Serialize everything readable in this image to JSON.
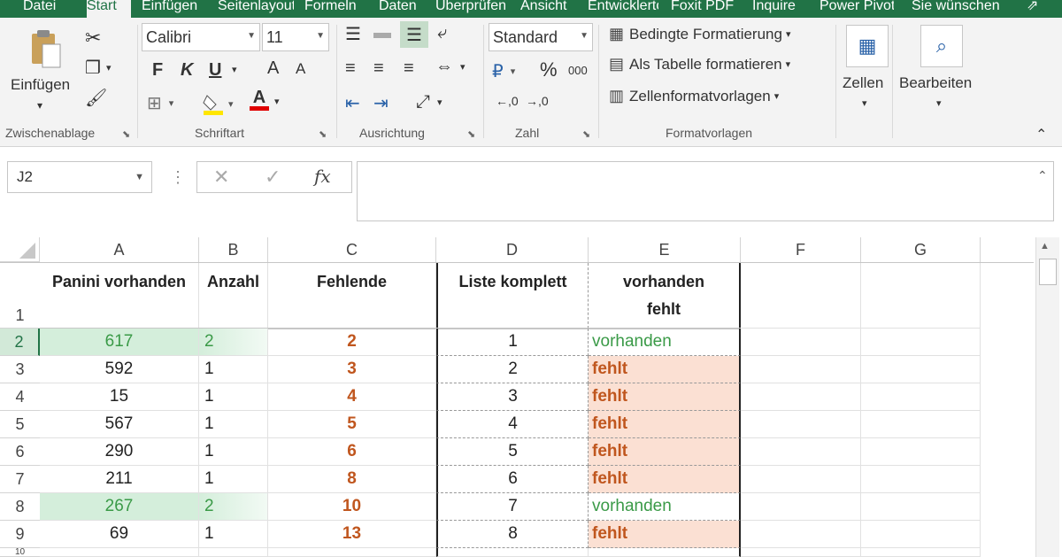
{
  "tabs": [
    "Datei",
    "Start",
    "Einfügen",
    "Seitenlayout",
    "Formeln",
    "Daten",
    "Überprüfen",
    "Ansicht",
    "Entwicklertools",
    "Foxit PDF",
    "Inquire",
    "Power Pivot",
    "Sie wünschen"
  ],
  "ribbon": {
    "clipboard": {
      "paste_label": "Einfügen",
      "group_label": "Zwischenablage"
    },
    "font": {
      "name": "Calibri",
      "size": "11",
      "bold": "F",
      "italic": "K",
      "underline": "U",
      "grow": "A",
      "shrink": "A",
      "color_letter": "A",
      "group_label": "Schriftart"
    },
    "alignment": {
      "group_label": "Ausrichtung"
    },
    "number": {
      "format": "Standard",
      "percent": "%",
      "thousands": "000",
      "group_label": "Zahl"
    },
    "styles": {
      "conditional": "Bedingte Formatierung",
      "as_table": "Als Tabelle formatieren",
      "cell_styles": "Zellenformatvorlagen",
      "group_label": "Formatvorlagen"
    },
    "cells": {
      "label": "Zellen"
    },
    "editing": {
      "label": "Bearbeiten"
    }
  },
  "formula_bar": {
    "name_box": "J2",
    "fx": "fx",
    "value": ""
  },
  "colors": {
    "excel_green": "#217346",
    "missing_fill": "#fbe0d3",
    "missing_text": "#c0561e",
    "present_text": "#3a9a47",
    "duplicate_fill": "#d4eedb"
  },
  "columns": [
    "A",
    "B",
    "C",
    "D",
    "E",
    "F",
    "G"
  ],
  "rows": [
    "1",
    "2",
    "3",
    "4",
    "5",
    "6",
    "7",
    "8",
    "9",
    "10"
  ],
  "headers": {
    "a": "Panini vorhanden",
    "b": "Anzahl",
    "c": "Fehlende",
    "d": "Liste komplett",
    "e": "vorhanden fehlt"
  },
  "data": [
    {
      "a": "617",
      "b": "2",
      "c": "2",
      "d": "1",
      "e": "vorhanden"
    },
    {
      "a": "592",
      "b": "1",
      "c": "3",
      "d": "2",
      "e": "fehlt"
    },
    {
      "a": "15",
      "b": "1",
      "c": "4",
      "d": "3",
      "e": "fehlt"
    },
    {
      "a": "567",
      "b": "1",
      "c": "5",
      "d": "4",
      "e": "fehlt"
    },
    {
      "a": "290",
      "b": "1",
      "c": "6",
      "d": "5",
      "e": "fehlt"
    },
    {
      "a": "211",
      "b": "1",
      "c": "8",
      "d": "6",
      "e": "fehlt"
    },
    {
      "a": "267",
      "b": "2",
      "c": "10",
      "d": "7",
      "e": "vorhanden"
    },
    {
      "a": "69",
      "b": "1",
      "c": "13",
      "d": "8",
      "e": "fehlt"
    }
  ]
}
